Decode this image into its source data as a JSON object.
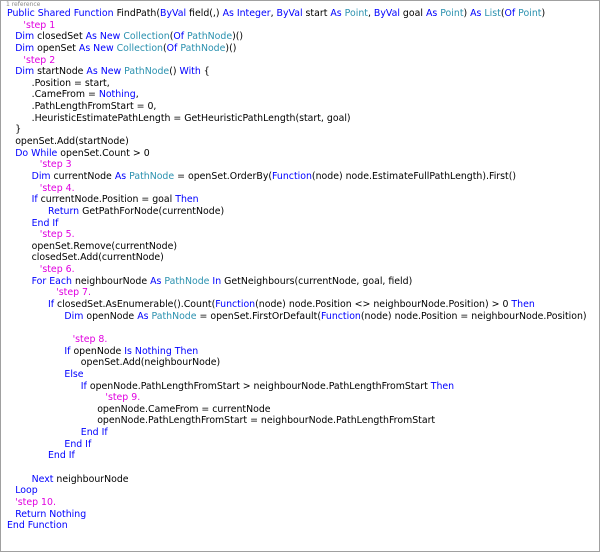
{
  "codelens": "1 reference",
  "colors": {
    "keyword": "#0000ff",
    "type": "#2b91af",
    "comment": "#e000e0",
    "text": "#000000",
    "codelens": "#8a8a8a"
  },
  "lines": [
    {
      "indent": 0,
      "tokens": [
        {
          "k": "kw",
          "v": "Public Shared Function "
        },
        {
          "k": "pl",
          "v": "FindPath("
        },
        {
          "k": "kw",
          "v": "ByVal "
        },
        {
          "k": "pl",
          "v": "field(,) "
        },
        {
          "k": "kw",
          "v": "As Integer"
        },
        {
          "k": "pl",
          "v": ", "
        },
        {
          "k": "kw",
          "v": "ByVal "
        },
        {
          "k": "pl",
          "v": "start "
        },
        {
          "k": "kw",
          "v": "As "
        },
        {
          "k": "ty",
          "v": "Point"
        },
        {
          "k": "pl",
          "v": ", "
        },
        {
          "k": "kw",
          "v": "ByVal "
        },
        {
          "k": "pl",
          "v": "goal "
        },
        {
          "k": "kw",
          "v": "As "
        },
        {
          "k": "ty",
          "v": "Point"
        },
        {
          "k": "pl",
          "v": ") "
        },
        {
          "k": "kw",
          "v": "As "
        },
        {
          "k": "ty",
          "v": "List"
        },
        {
          "k": "pl",
          "v": "("
        },
        {
          "k": "kw",
          "v": "Of "
        },
        {
          "k": "ty",
          "v": "Point"
        },
        {
          "k": "pl",
          "v": ")"
        }
      ]
    },
    {
      "indent": 2,
      "tokens": [
        {
          "k": "cm",
          "v": "'step 1"
        }
      ]
    },
    {
      "indent": 1,
      "tokens": [
        {
          "k": "kw",
          "v": "Dim "
        },
        {
          "k": "pl",
          "v": "closedSet "
        },
        {
          "k": "kw",
          "v": "As New "
        },
        {
          "k": "ty",
          "v": "Collection"
        },
        {
          "k": "pl",
          "v": "("
        },
        {
          "k": "kw",
          "v": "Of "
        },
        {
          "k": "ty",
          "v": "PathNode"
        },
        {
          "k": "pl",
          "v": ")()"
        }
      ]
    },
    {
      "indent": 1,
      "tokens": [
        {
          "k": "kw",
          "v": "Dim "
        },
        {
          "k": "pl",
          "v": "openSet "
        },
        {
          "k": "kw",
          "v": "As New "
        },
        {
          "k": "ty",
          "v": "Collection"
        },
        {
          "k": "pl",
          "v": "("
        },
        {
          "k": "kw",
          "v": "Of "
        },
        {
          "k": "ty",
          "v": "PathNode"
        },
        {
          "k": "pl",
          "v": ")()"
        }
      ]
    },
    {
      "indent": 2,
      "tokens": [
        {
          "k": "cm",
          "v": "'step 2"
        }
      ]
    },
    {
      "indent": 1,
      "tokens": [
        {
          "k": "kw",
          "v": "Dim "
        },
        {
          "k": "pl",
          "v": "startNode "
        },
        {
          "k": "kw",
          "v": "As New "
        },
        {
          "k": "ty",
          "v": "PathNode"
        },
        {
          "k": "pl",
          "v": "() "
        },
        {
          "k": "kw",
          "v": "With "
        },
        {
          "k": "pl",
          "v": "{"
        }
      ]
    },
    {
      "indent": 3,
      "tokens": [
        {
          "k": "pl",
          "v": ".Position = start,"
        }
      ]
    },
    {
      "indent": 3,
      "tokens": [
        {
          "k": "pl",
          "v": ".CameFrom = "
        },
        {
          "k": "kw",
          "v": "Nothing"
        },
        {
          "k": "pl",
          "v": ","
        }
      ]
    },
    {
      "indent": 3,
      "tokens": [
        {
          "k": "pl",
          "v": ".PathLengthFromStart = 0,"
        }
      ]
    },
    {
      "indent": 3,
      "tokens": [
        {
          "k": "pl",
          "v": ".HeuristicEstimatePathLength = GetHeuristicPathLength(start, goal)"
        }
      ]
    },
    {
      "indent": 1,
      "tokens": [
        {
          "k": "pl",
          "v": "}"
        }
      ]
    },
    {
      "indent": 1,
      "tokens": [
        {
          "k": "pl",
          "v": "openSet.Add(startNode)"
        }
      ]
    },
    {
      "indent": 1,
      "tokens": [
        {
          "k": "kw",
          "v": "Do While "
        },
        {
          "k": "pl",
          "v": "openSet.Count > 0"
        }
      ]
    },
    {
      "indent": 4,
      "tokens": [
        {
          "k": "cm",
          "v": "'step 3"
        }
      ]
    },
    {
      "indent": 3,
      "tokens": [
        {
          "k": "kw",
          "v": "Dim "
        },
        {
          "k": "pl",
          "v": "currentNode "
        },
        {
          "k": "kw",
          "v": "As "
        },
        {
          "k": "ty",
          "v": "PathNode"
        },
        {
          "k": "pl",
          "v": " = openSet.OrderBy("
        },
        {
          "k": "kw",
          "v": "Function"
        },
        {
          "k": "pl",
          "v": "(node) node.EstimateFullPathLength).First()"
        }
      ]
    },
    {
      "indent": 4,
      "tokens": [
        {
          "k": "cm",
          "v": "'step 4."
        }
      ]
    },
    {
      "indent": 3,
      "tokens": [
        {
          "k": "kw",
          "v": "If "
        },
        {
          "k": "pl",
          "v": "currentNode.Position = goal "
        },
        {
          "k": "kw",
          "v": "Then"
        }
      ]
    },
    {
      "indent": 5,
      "tokens": [
        {
          "k": "kw",
          "v": "Return "
        },
        {
          "k": "pl",
          "v": "GetPathForNode(currentNode)"
        }
      ]
    },
    {
      "indent": 3,
      "tokens": [
        {
          "k": "kw",
          "v": "End If"
        }
      ]
    },
    {
      "indent": 4,
      "tokens": [
        {
          "k": "cm",
          "v": "'step 5."
        }
      ]
    },
    {
      "indent": 3,
      "tokens": [
        {
          "k": "pl",
          "v": "openSet.Remove(currentNode)"
        }
      ]
    },
    {
      "indent": 3,
      "tokens": [
        {
          "k": "pl",
          "v": "closedSet.Add(currentNode)"
        }
      ]
    },
    {
      "indent": 4,
      "tokens": [
        {
          "k": "cm",
          "v": "'step 6."
        }
      ]
    },
    {
      "indent": 3,
      "tokens": [
        {
          "k": "kw",
          "v": "For Each "
        },
        {
          "k": "pl",
          "v": "neighbourNode "
        },
        {
          "k": "kw",
          "v": "As "
        },
        {
          "k": "ty",
          "v": "PathNode"
        },
        {
          "k": "kw",
          "v": " In "
        },
        {
          "k": "pl",
          "v": "GetNeighbours(currentNode, goal, field)"
        }
      ]
    },
    {
      "indent": 6,
      "tokens": [
        {
          "k": "cm",
          "v": "'step 7."
        }
      ]
    },
    {
      "indent": 5,
      "tokens": [
        {
          "k": "kw",
          "v": "If "
        },
        {
          "k": "pl",
          "v": "closedSet.AsEnumerable().Count("
        },
        {
          "k": "kw",
          "v": "Function"
        },
        {
          "k": "pl",
          "v": "(node) node.Position <> neighbourNode.Position) > 0 "
        },
        {
          "k": "kw",
          "v": "Then"
        }
      ]
    },
    {
      "indent": 7,
      "tokens": [
        {
          "k": "kw",
          "v": "Dim "
        },
        {
          "k": "pl",
          "v": "openNode "
        },
        {
          "k": "kw",
          "v": "As "
        },
        {
          "k": "ty",
          "v": "PathNode"
        },
        {
          "k": "pl",
          "v": " = openSet.FirstOrDefault("
        },
        {
          "k": "kw",
          "v": "Function"
        },
        {
          "k": "pl",
          "v": "(node) node.Position = neighbourNode.Position)"
        }
      ]
    },
    {
      "indent": 0,
      "tokens": []
    },
    {
      "indent": 8,
      "tokens": [
        {
          "k": "cm",
          "v": "'step 8."
        }
      ]
    },
    {
      "indent": 7,
      "tokens": [
        {
          "k": "kw",
          "v": "If "
        },
        {
          "k": "pl",
          "v": "openNode "
        },
        {
          "k": "kw",
          "v": "Is Nothing Then"
        }
      ]
    },
    {
      "indent": 9,
      "tokens": [
        {
          "k": "pl",
          "v": "openSet.Add(neighbourNode)"
        }
      ]
    },
    {
      "indent": 7,
      "tokens": [
        {
          "k": "kw",
          "v": "Else"
        }
      ]
    },
    {
      "indent": 9,
      "tokens": [
        {
          "k": "kw",
          "v": "If "
        },
        {
          "k": "pl",
          "v": "openNode.PathLengthFromStart > neighbourNode.PathLengthFromStart "
        },
        {
          "k": "kw",
          "v": "Then"
        }
      ]
    },
    {
      "indent": 12,
      "tokens": [
        {
          "k": "cm",
          "v": "'step 9."
        }
      ]
    },
    {
      "indent": 11,
      "tokens": [
        {
          "k": "pl",
          "v": "openNode.CameFrom = currentNode"
        }
      ]
    },
    {
      "indent": 11,
      "tokens": [
        {
          "k": "pl",
          "v": "openNode.PathLengthFromStart = neighbourNode.PathLengthFromStart"
        }
      ]
    },
    {
      "indent": 9,
      "tokens": [
        {
          "k": "kw",
          "v": "End If"
        }
      ]
    },
    {
      "indent": 7,
      "tokens": [
        {
          "k": "kw",
          "v": "End If"
        }
      ]
    },
    {
      "indent": 5,
      "tokens": [
        {
          "k": "kw",
          "v": "End If"
        }
      ]
    },
    {
      "indent": 0,
      "tokens": []
    },
    {
      "indent": 3,
      "tokens": [
        {
          "k": "kw",
          "v": "Next "
        },
        {
          "k": "pl",
          "v": "neighbourNode"
        }
      ]
    },
    {
      "indent": 1,
      "tokens": [
        {
          "k": "kw",
          "v": "Loop"
        }
      ]
    },
    {
      "indent": 1,
      "tokens": [
        {
          "k": "cm",
          "v": "'step 10."
        }
      ]
    },
    {
      "indent": 1,
      "tokens": [
        {
          "k": "kw",
          "v": "Return "
        },
        {
          "k": "kw",
          "v": "Nothing"
        }
      ]
    },
    {
      "indent": 0,
      "tokens": [
        {
          "k": "kw",
          "v": "End Function"
        }
      ]
    }
  ]
}
